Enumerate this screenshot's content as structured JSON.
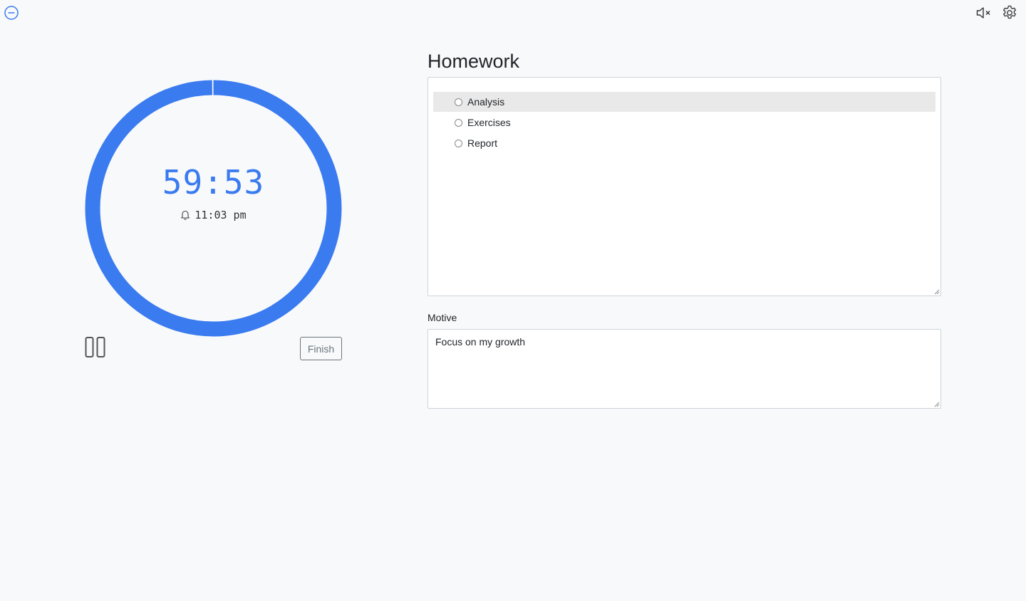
{
  "toolbar": {
    "minimize_icon": "minus-circle-icon",
    "mute_icon": "volume-mute-icon",
    "settings_icon": "gear-icon"
  },
  "timer": {
    "remaining": "59:53",
    "alarm_time": "11:03 pm",
    "alarm_icon": "bell-icon",
    "progress_fraction": 0.998,
    "ring_color": "#3a7bf0",
    "pause_icon": "pause-icon",
    "finish_label": "Finish"
  },
  "task": {
    "title": "Homework",
    "subtasks": [
      {
        "label": "Analysis",
        "active": true
      },
      {
        "label": "Exercises",
        "active": false
      },
      {
        "label": "Report",
        "active": false
      }
    ]
  },
  "motive": {
    "label": "Motive",
    "value": "Focus on my growth"
  }
}
